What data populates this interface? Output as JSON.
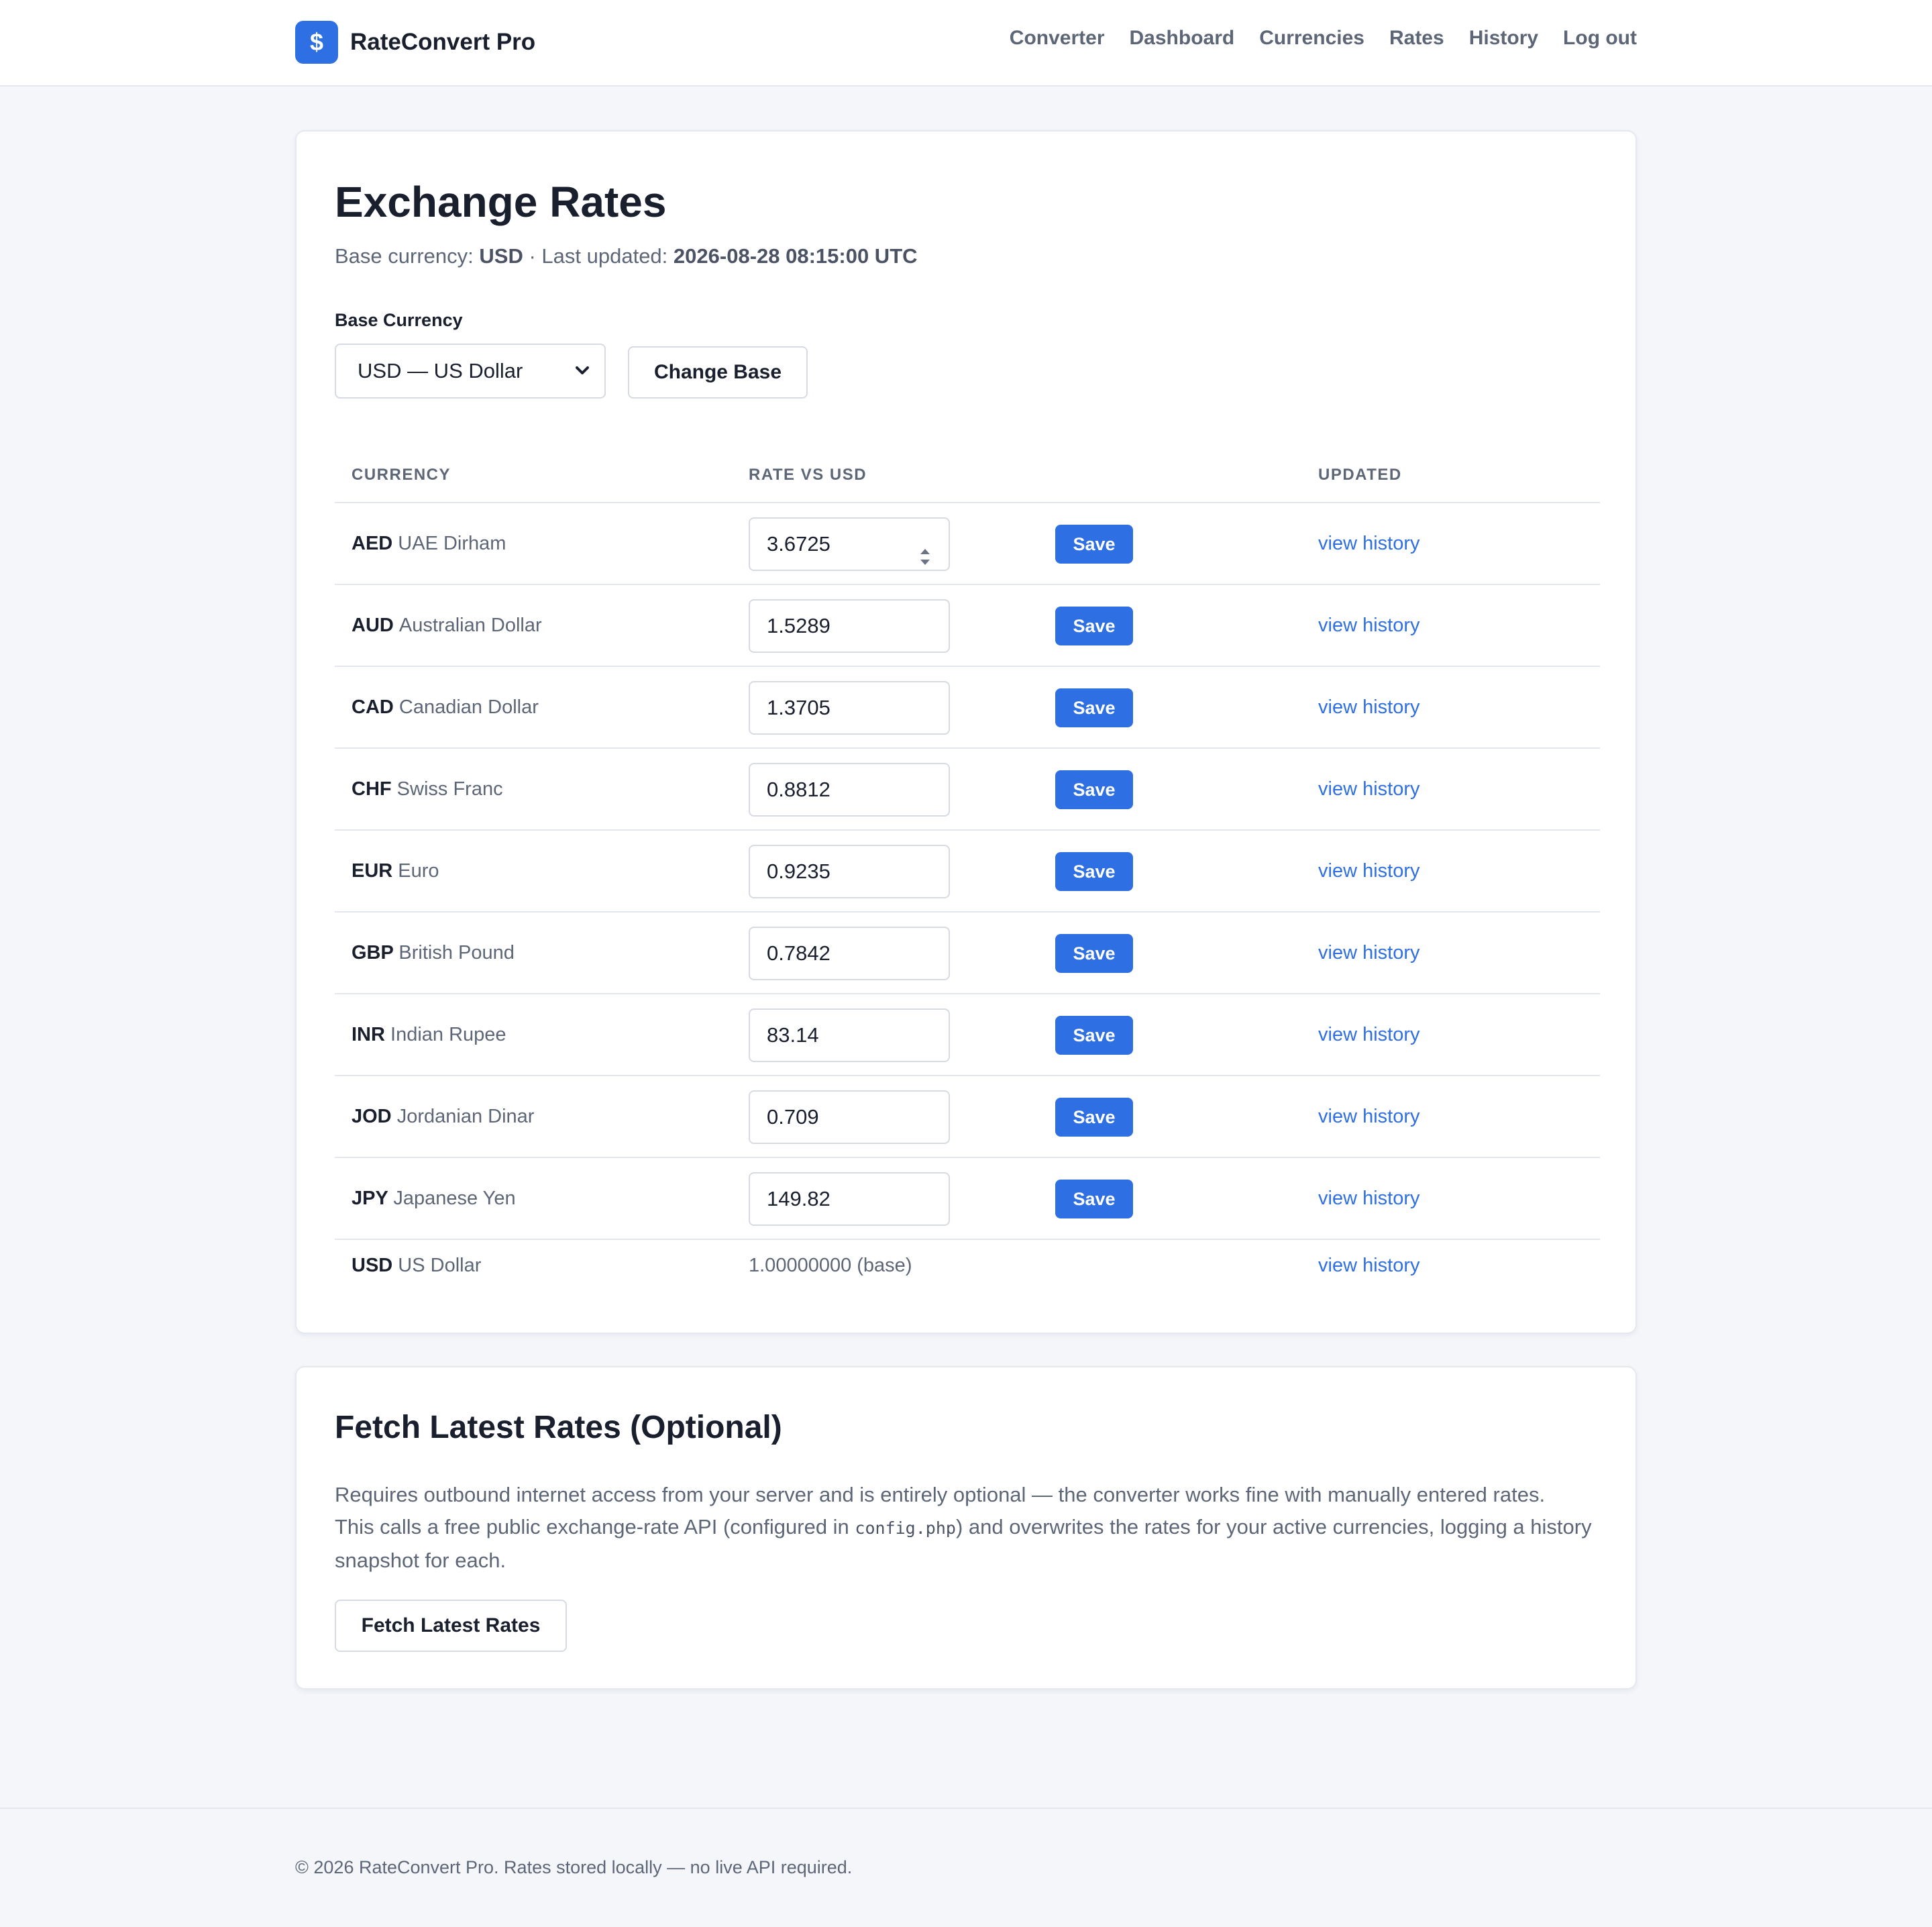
{
  "brand": {
    "logo_symbol": "$",
    "name": "RateConvert Pro",
    "accent": "#2f6fe4"
  },
  "nav": [
    "Converter",
    "Dashboard",
    "Currencies",
    "Rates",
    "History",
    "Log out"
  ],
  "page": {
    "title": "Exchange Rates",
    "meta_prefix": "Base currency:",
    "base_code": "USD",
    "meta_sep": "· Last updated:",
    "last_updated": "2026-08-28 08:15:00 UTC"
  },
  "base_form": {
    "label": "Base Currency",
    "selected": "USD — US Dollar",
    "button": "Change Base"
  },
  "table": {
    "headers": [
      "CURRENCY",
      "RATE VS USD",
      "UPDATED"
    ],
    "save_label": "Save",
    "history_label": "view history",
    "rows": [
      {
        "code": "AED",
        "name": "UAE Dirham",
        "rate": "3.6725"
      },
      {
        "code": "AUD",
        "name": "Australian Dollar",
        "rate": "1.5289"
      },
      {
        "code": "CAD",
        "name": "Canadian Dollar",
        "rate": "1.3705"
      },
      {
        "code": "CHF",
        "name": "Swiss Franc",
        "rate": "0.8812"
      },
      {
        "code": "EUR",
        "name": "Euro",
        "rate": "0.9235"
      },
      {
        "code": "GBP",
        "name": "British Pound",
        "rate": "0.7842"
      },
      {
        "code": "INR",
        "name": "Indian Rupee",
        "rate": "83.14"
      },
      {
        "code": "JOD",
        "name": "Jordanian Dinar",
        "rate": "0.709"
      },
      {
        "code": "JPY",
        "name": "Japanese Yen",
        "rate": "149.82"
      }
    ],
    "base_row": {
      "code": "USD",
      "name": "US Dollar",
      "rate": "1.00000000 (base)"
    }
  },
  "fetch": {
    "title": "Fetch Latest Rates (Optional)",
    "para_1": "Requires outbound internet access from your server and is entirely optional — the converter works fine with manually entered rates.",
    "para_2a": "This calls a free public exchange-rate API (configured in",
    "config_file": "config.php",
    "para_2b": ") and overwrites the rates for your active currencies, logging a history snapshot for each.",
    "button": "Fetch Latest Rates"
  },
  "footer": "© 2026 RateConvert Pro. Rates stored locally — no live API required."
}
